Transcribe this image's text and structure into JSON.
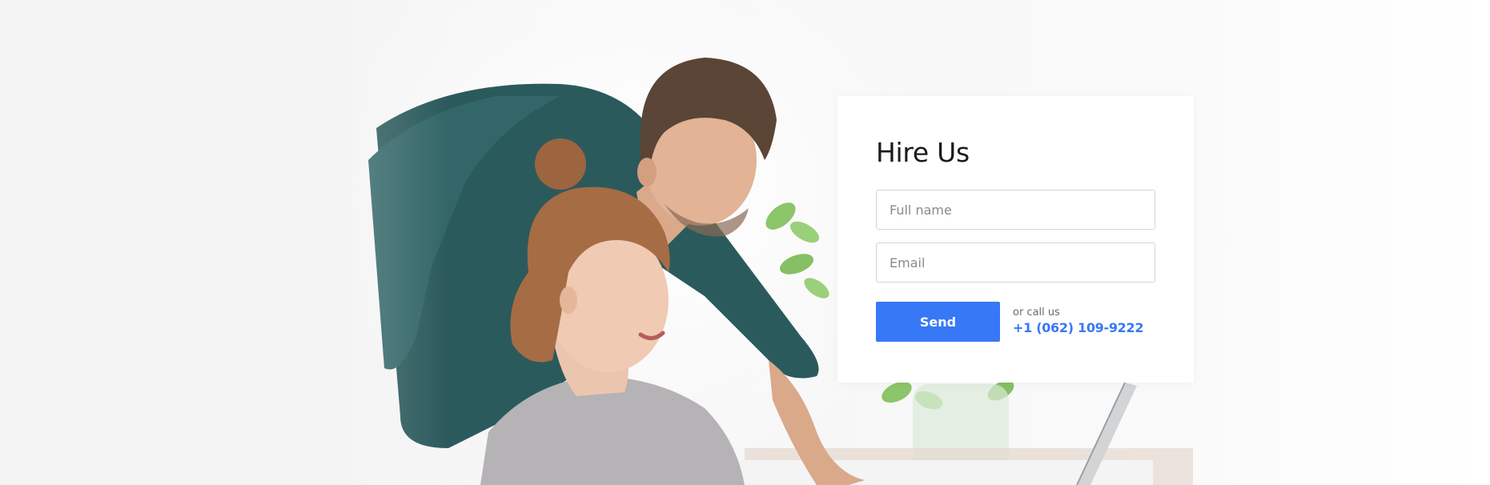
{
  "hire_form": {
    "title": "Hire Us",
    "name_placeholder": "Full name",
    "email_placeholder": "Email",
    "send_label": "Send",
    "call_label": "or call us",
    "phone": "+1 (062) 109-9222"
  },
  "colors": {
    "accent": "#3778f6",
    "title_text": "#1b1b1b",
    "field_border": "#d5d5d8",
    "background": "#f6f6f6"
  },
  "hero_image": {
    "subject": "couple-at-laptop-photo"
  }
}
